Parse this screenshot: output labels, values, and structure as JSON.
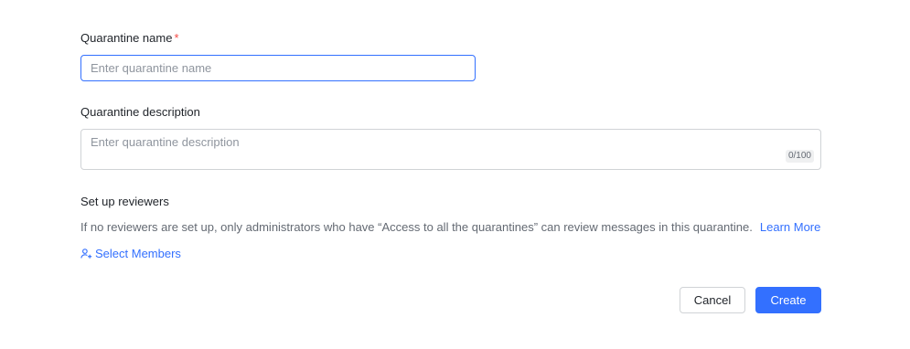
{
  "form": {
    "name": {
      "label": "Quarantine name",
      "required_mark": "*",
      "value": "",
      "placeholder": "Enter quarantine name"
    },
    "description": {
      "label": "Quarantine description",
      "value": "",
      "placeholder": "Enter quarantine description",
      "counter": "0/100"
    },
    "reviewers": {
      "label": "Set up reviewers",
      "helper_text": "If no reviewers are set up, only administrators who have “Access to all the quarantines” can review messages in this quarantine.",
      "learn_more": "Learn More",
      "select_members": "Select Members",
      "select_members_icon": "add-user-icon"
    }
  },
  "actions": {
    "cancel": "Cancel",
    "create": "Create"
  },
  "colors": {
    "accent": "#3370ff",
    "required": "#f54a45",
    "text_primary": "#1f2329",
    "text_secondary": "#646a73",
    "border": "#d0d3d6"
  }
}
